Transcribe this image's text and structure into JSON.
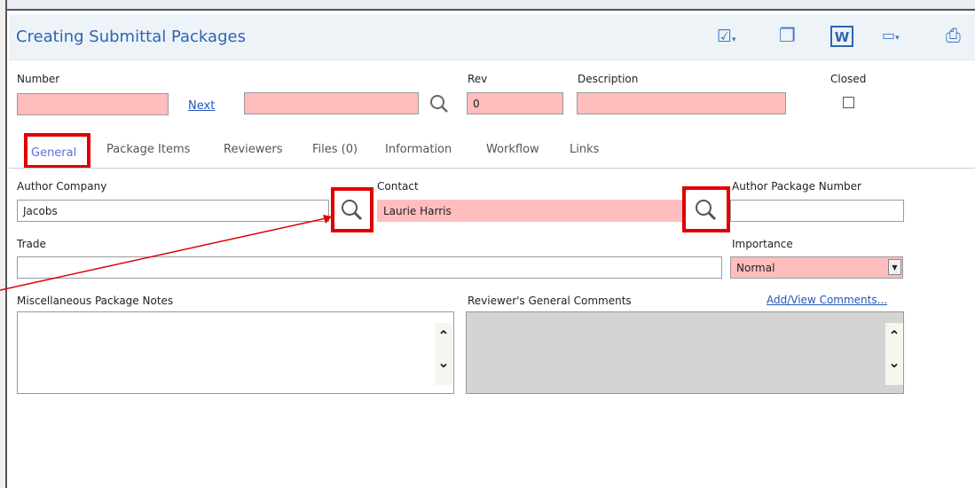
{
  "header": {
    "title": "Creating Submittal Packages",
    "toolbar": [
      {
        "icon": "checkmark-dropdown-icon",
        "glyph": "☑▾"
      },
      {
        "icon": "copy-window-icon",
        "glyph": "❐"
      },
      {
        "icon": "word-icon",
        "glyph": "W"
      },
      {
        "icon": "link-dropdown-icon",
        "glyph": "▭▾"
      },
      {
        "icon": "print-icon",
        "glyph": "⎙"
      }
    ]
  },
  "form": {
    "number_label": "Number",
    "number_value": "",
    "next_link": "Next",
    "number2_value": "",
    "rev_label": "Rev",
    "rev_value": "0",
    "description_label": "Description",
    "description_value": "",
    "closed_label": "Closed"
  },
  "tabs": [
    "General",
    "Package Items",
    "Reviewers",
    "Files (0)",
    "Information",
    "Workflow",
    "Links"
  ],
  "general": {
    "author_company_label": "Author Company",
    "author_company_value": "Jacobs",
    "contact_label": "Contact",
    "contact_value": "Laurie Harris",
    "author_package_number_label": "Author Package Number",
    "author_package_number_value": "",
    "trade_label": "Trade",
    "trade_value": "",
    "importance_label": "Importance",
    "importance_value": "Normal",
    "misc_notes_label": "Miscellaneous Package Notes",
    "reviewers_comments_label": "Reviewer's General Comments",
    "add_view_comments_link": "Add/View Comments..."
  },
  "colors": {
    "required_field": "#ffbdbd",
    "highlight": "#e00000",
    "title": "#2a66b2"
  }
}
